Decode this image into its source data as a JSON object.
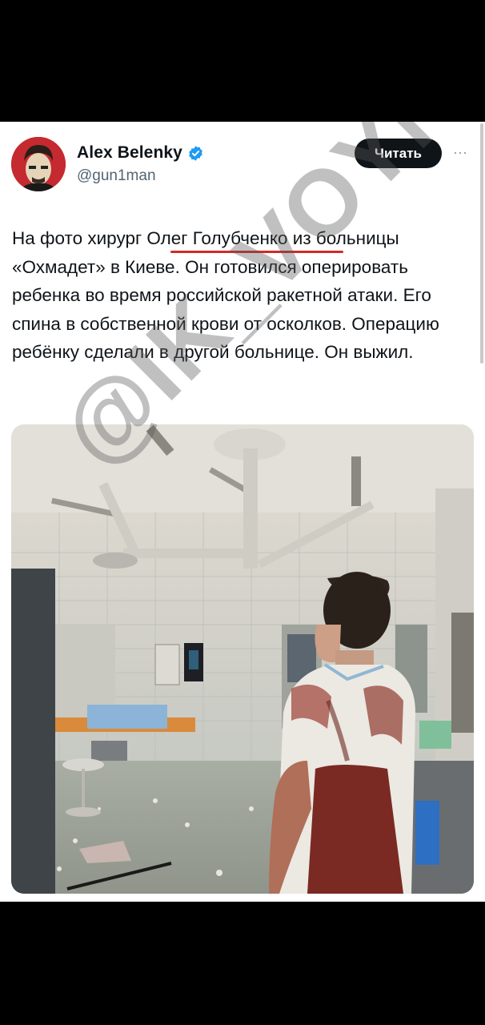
{
  "tweet": {
    "author_name": "Alex Belenky",
    "handle": "@gun1man",
    "follow_label": "Читать",
    "more_label": "···",
    "text": "На фото хирург Олег Голубченко из больницы «Охмадет» в Киеве. Он готовился оперировать ребенка во время российской ракетной атаки. Его спина в собственной крови от осколков. Операцию ребёнку сделали в другой больнице. Он выжил.",
    "photo_icon": "photo-operating-room"
  },
  "overlay": {
    "watermark": "@IK_VOYNA"
  },
  "colors": {
    "accent_verified": "#1d9bf0",
    "underline": "#d22a2a",
    "button_bg": "#0f1419"
  }
}
